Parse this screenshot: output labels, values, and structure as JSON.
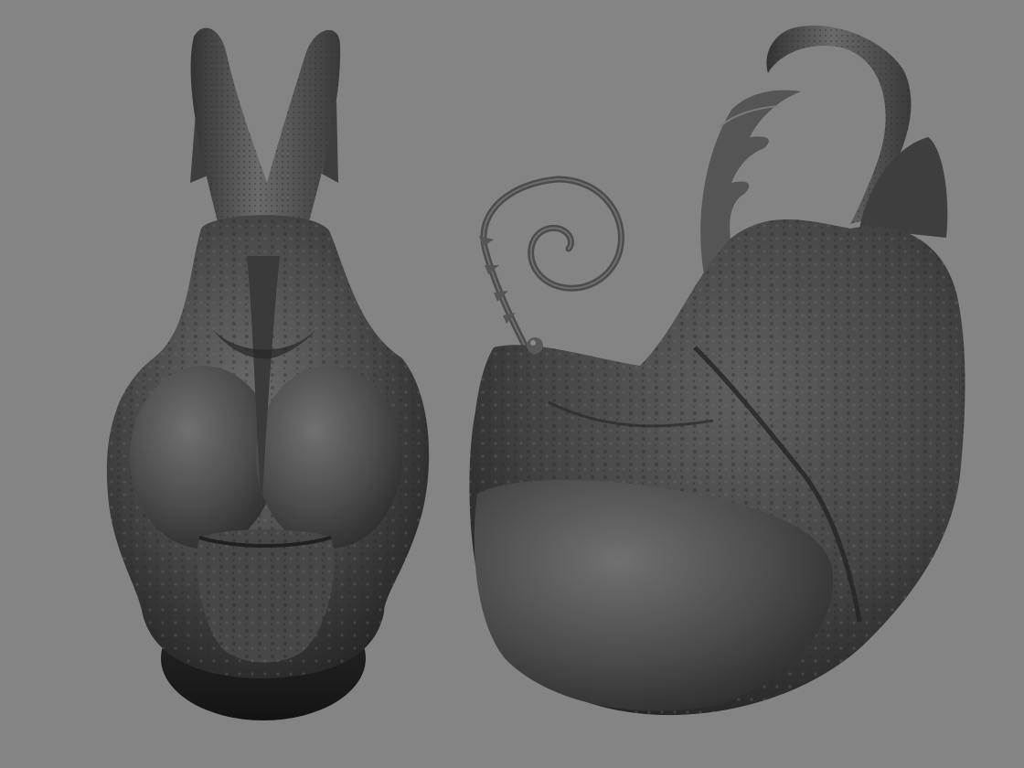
{
  "scene": {
    "background_color": "#848484",
    "material_color": "#4a4a4a",
    "highlight_color": "#7c7c7c",
    "shadow_color": "#1e1e1e",
    "subjects": [
      "creature-head-front-view",
      "creature-head-side-view"
    ]
  }
}
